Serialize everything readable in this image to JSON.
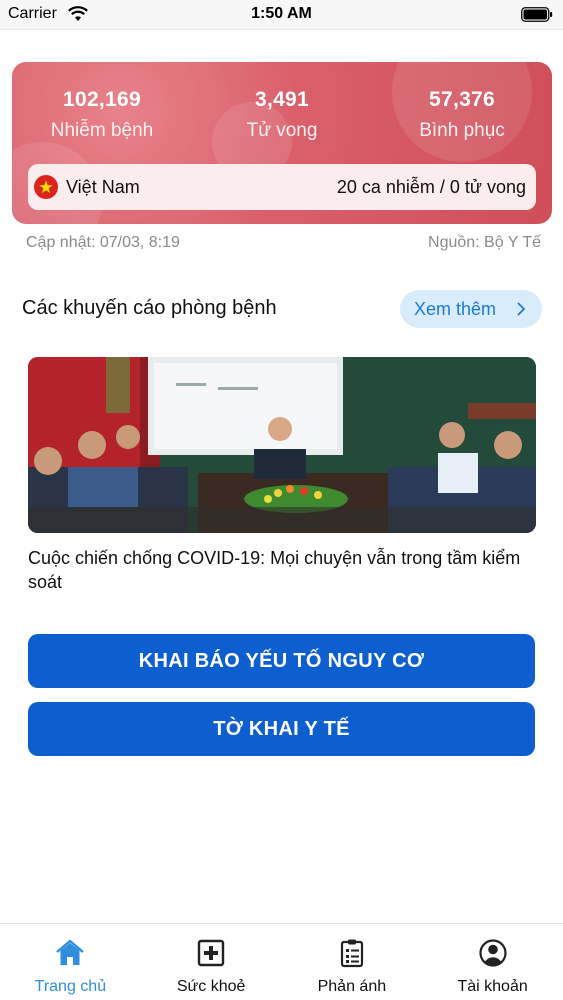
{
  "status_bar": {
    "carrier": "Carrier",
    "time": "1:50 AM"
  },
  "stats": {
    "infected": {
      "value": "102,169",
      "label": "Nhiễm bệnh"
    },
    "deaths": {
      "value": "3,491",
      "label": "Tử vong"
    },
    "recovered": {
      "value": "57,376",
      "label": "Bình phục"
    }
  },
  "country": {
    "name": "Việt Nam",
    "summary": "20 ca nhiễm / 0 tử vong",
    "flag_color": "#da251d"
  },
  "meta": {
    "updated": "Cập nhật: 07/03, 8:19",
    "source": "Nguồn: Bộ Y Tế"
  },
  "recommendations": {
    "title": "Các khuyến cáo phòng bệnh",
    "more_label": "Xem thêm"
  },
  "news": {
    "caption": "Cuộc chiến chống COVID-19: Mọi chuyện vẫn trong tầm kiểm soát"
  },
  "actions": {
    "declare_risk": "KHAI BÁO YẾU TỐ NGUY CƠ",
    "health_declaration": "TỜ KHAI Y TẾ"
  },
  "tabs": [
    {
      "label": "Trang chủ",
      "icon": "home-icon",
      "active": true
    },
    {
      "label": "Sức khoẻ",
      "icon": "medical-cross-icon",
      "active": false
    },
    {
      "label": "Phản ánh",
      "icon": "clipboard-icon",
      "active": false
    },
    {
      "label": "Tài khoản",
      "icon": "account-icon",
      "active": false
    }
  ],
  "colors": {
    "accent": "#2f8fde",
    "button": "#0d5fd0",
    "card": "#d9606b"
  }
}
